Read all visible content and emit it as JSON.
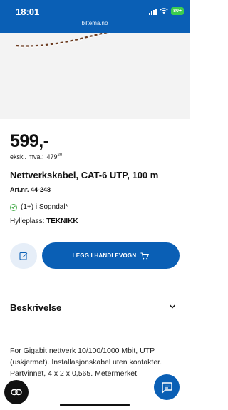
{
  "status_bar": {
    "time": "18:01",
    "url": "biltema.no",
    "battery": "80+"
  },
  "product": {
    "price": "599,-",
    "excl_vat_label": "ekskl. mva.:",
    "excl_vat_value": "479",
    "excl_vat_cents": "20",
    "title": "Nettverkskabel, CAT-6 UTP, 100 m",
    "article_number": "Art.nr. 44-248",
    "stock": "(1+) i Sogndal*",
    "shelf_label": "Hylleplass:",
    "shelf_value": "TEKNIKK"
  },
  "actions": {
    "add_to_cart": "LEGG I HANDLEVOGN"
  },
  "description": {
    "heading": "Beskrivelse",
    "text": "For Gigabit nettverk 10/100/1000 Mbit, UTP (uskjermet). Installasjonskabel uten kontakter. Partvinnet, 4 x 2 x 0,565. Metermerket."
  },
  "colors": {
    "brand_blue": "#0a5fb5",
    "check_green": "#4caf50"
  },
  "icons": [
    "wifi-icon",
    "signal-icon",
    "battery-icon",
    "edit-icon",
    "cart-icon",
    "chevron-down-icon",
    "chat-icon",
    "link-icon"
  ]
}
